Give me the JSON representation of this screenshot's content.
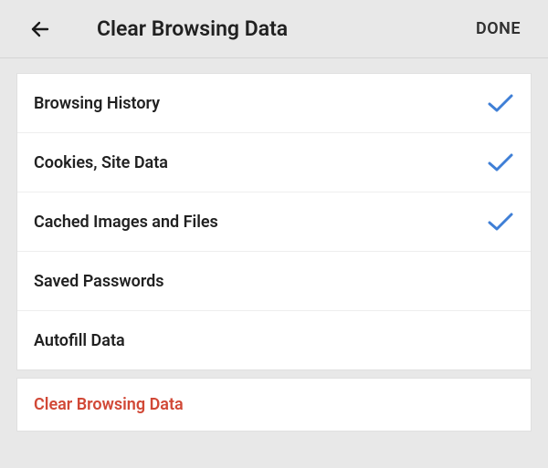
{
  "header": {
    "title": "Clear Browsing Data",
    "done_label": "DONE"
  },
  "options": [
    {
      "label": "Browsing History",
      "checked": true
    },
    {
      "label": "Cookies, Site Data",
      "checked": true
    },
    {
      "label": "Cached Images and Files",
      "checked": true
    },
    {
      "label": "Saved Passwords",
      "checked": false
    },
    {
      "label": "Autofill Data",
      "checked": false
    }
  ],
  "action": {
    "label": "Clear Browsing Data"
  },
  "colors": {
    "accent_check": "#3f7fd6",
    "action_text": "#d14836"
  }
}
